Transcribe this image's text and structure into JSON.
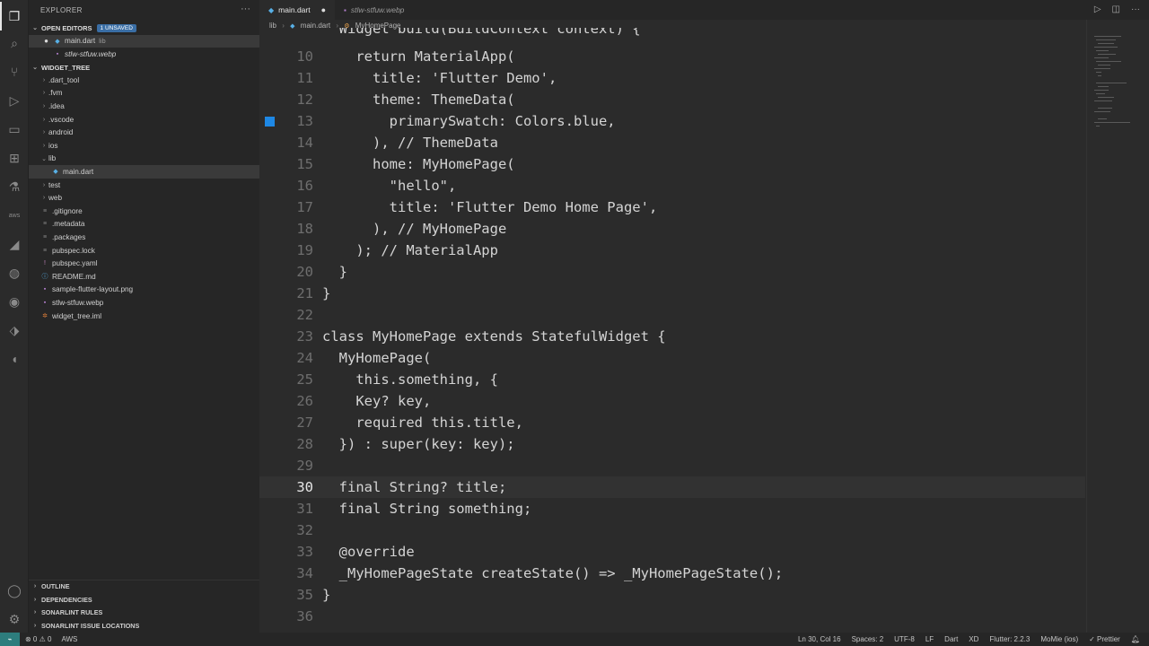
{
  "activity_bar": {
    "icons": [
      "files-icon",
      "search-icon",
      "source-control-icon",
      "run-debug-icon",
      "remote-explorer-icon",
      "extensions-icon",
      "testing-icon",
      "aws-icon",
      "flutter-icon",
      "docker-icon",
      "sonarlint-icon",
      "firebase-icon",
      "gitlens-icon",
      "account-icon",
      "settings-gear-icon"
    ],
    "aws_label": "aws"
  },
  "sidebar": {
    "header": "EXPLORER",
    "more": "···",
    "open_editors": {
      "title": "OPEN EDITORS",
      "badge": "1 UNSAVED",
      "items": [
        {
          "name": "main.dart",
          "hint": "lib",
          "dirty": "●"
        },
        {
          "name": "stlw-stfuw.webp",
          "hint": ""
        }
      ]
    },
    "workspace": {
      "title": "WIDGET_TREE",
      "items": [
        {
          "label": ".dart_tool",
          "kind": "folder",
          "chev": "›"
        },
        {
          "label": ".fvm",
          "kind": "folder",
          "chev": "›"
        },
        {
          "label": ".idea",
          "kind": "folder",
          "chev": "›"
        },
        {
          "label": ".vscode",
          "kind": "folder",
          "chev": "›"
        },
        {
          "label": "android",
          "kind": "folder",
          "chev": "›"
        },
        {
          "label": "ios",
          "kind": "folder",
          "chev": "›"
        },
        {
          "label": "lib",
          "kind": "folder-open",
          "chev": "⌄"
        },
        {
          "label": "main.dart",
          "kind": "dart"
        },
        {
          "label": "test",
          "kind": "folder",
          "chev": "›"
        },
        {
          "label": "web",
          "kind": "folder",
          "chev": "›"
        },
        {
          "label": ".gitignore",
          "kind": "file"
        },
        {
          "label": ".metadata",
          "kind": "file"
        },
        {
          "label": ".packages",
          "kind": "file"
        },
        {
          "label": "pubspec.lock",
          "kind": "file"
        },
        {
          "label": "pubspec.yaml",
          "kind": "yaml"
        },
        {
          "label": "README.md",
          "kind": "md"
        },
        {
          "label": "sample-flutter-layout.png",
          "kind": "image"
        },
        {
          "label": "stlw-stfuw.webp",
          "kind": "image"
        },
        {
          "label": "widget_tree.iml",
          "kind": "iml"
        }
      ]
    },
    "bottom_sections": [
      "OUTLINE",
      "DEPENDENCIES",
      "SONARLINT RULES",
      "SONARLINT ISSUE LOCATIONS"
    ]
  },
  "editor": {
    "tabs": [
      {
        "label": "main.dart",
        "active": true,
        "dirty": "●"
      },
      {
        "label": "stlw-stfuw.webp",
        "active": false
      }
    ],
    "breadcrumb": [
      "lib",
      "›",
      "main.dart",
      "›",
      "MyHomePage"
    ],
    "first_line_partial": "  Widget build(BuildContext context) {",
    "lines": [
      {
        "n": "10",
        "text": "    return MaterialApp("
      },
      {
        "n": "11",
        "text": "      title: 'Flutter Demo',"
      },
      {
        "n": "12",
        "text": "      theme: ThemeData("
      },
      {
        "n": "13",
        "text": "        primarySwatch: Colors.blue,"
      },
      {
        "n": "14",
        "text": "      ), // ThemeData"
      },
      {
        "n": "15",
        "text": "      home: MyHomePage("
      },
      {
        "n": "16",
        "text": "        \"hello\","
      },
      {
        "n": "17",
        "text": "        title: 'Flutter Demo Home Page',"
      },
      {
        "n": "18",
        "text": "      ), // MyHomePage"
      },
      {
        "n": "19",
        "text": "    ); // MaterialApp"
      },
      {
        "n": "20",
        "text": "  }"
      },
      {
        "n": "21",
        "text": "}"
      },
      {
        "n": "22",
        "text": ""
      },
      {
        "n": "23",
        "text": "class MyHomePage extends StatefulWidget {"
      },
      {
        "n": "24",
        "text": "  MyHomePage("
      },
      {
        "n": "25",
        "text": "    this.something, {"
      },
      {
        "n": "26",
        "text": "    Key? key,"
      },
      {
        "n": "27",
        "text": "    required this.title,"
      },
      {
        "n": "28",
        "text": "  }) : super(key: key);"
      },
      {
        "n": "29",
        "text": ""
      },
      {
        "n": "30",
        "text": "  final String? title;"
      },
      {
        "n": "31",
        "text": "  final String something;"
      },
      {
        "n": "32",
        "text": ""
      },
      {
        "n": "33",
        "text": "  @override"
      },
      {
        "n": "34",
        "text": "  _MyHomePageState createState() => _MyHomePageState();"
      },
      {
        "n": "35",
        "text": "}"
      },
      {
        "n": "36",
        "text": ""
      }
    ],
    "current_line": "30"
  },
  "status_bar": {
    "left": [
      "⊗ 0 ⚠ 0",
      "AWS"
    ],
    "right": [
      "Ln 30, Col 16",
      "Spaces: 2",
      "UTF-8",
      "LF",
      "Dart",
      "XD",
      "Flutter: 2.2.3",
      "MoMie (ios)",
      "✓ Prettier"
    ]
  }
}
